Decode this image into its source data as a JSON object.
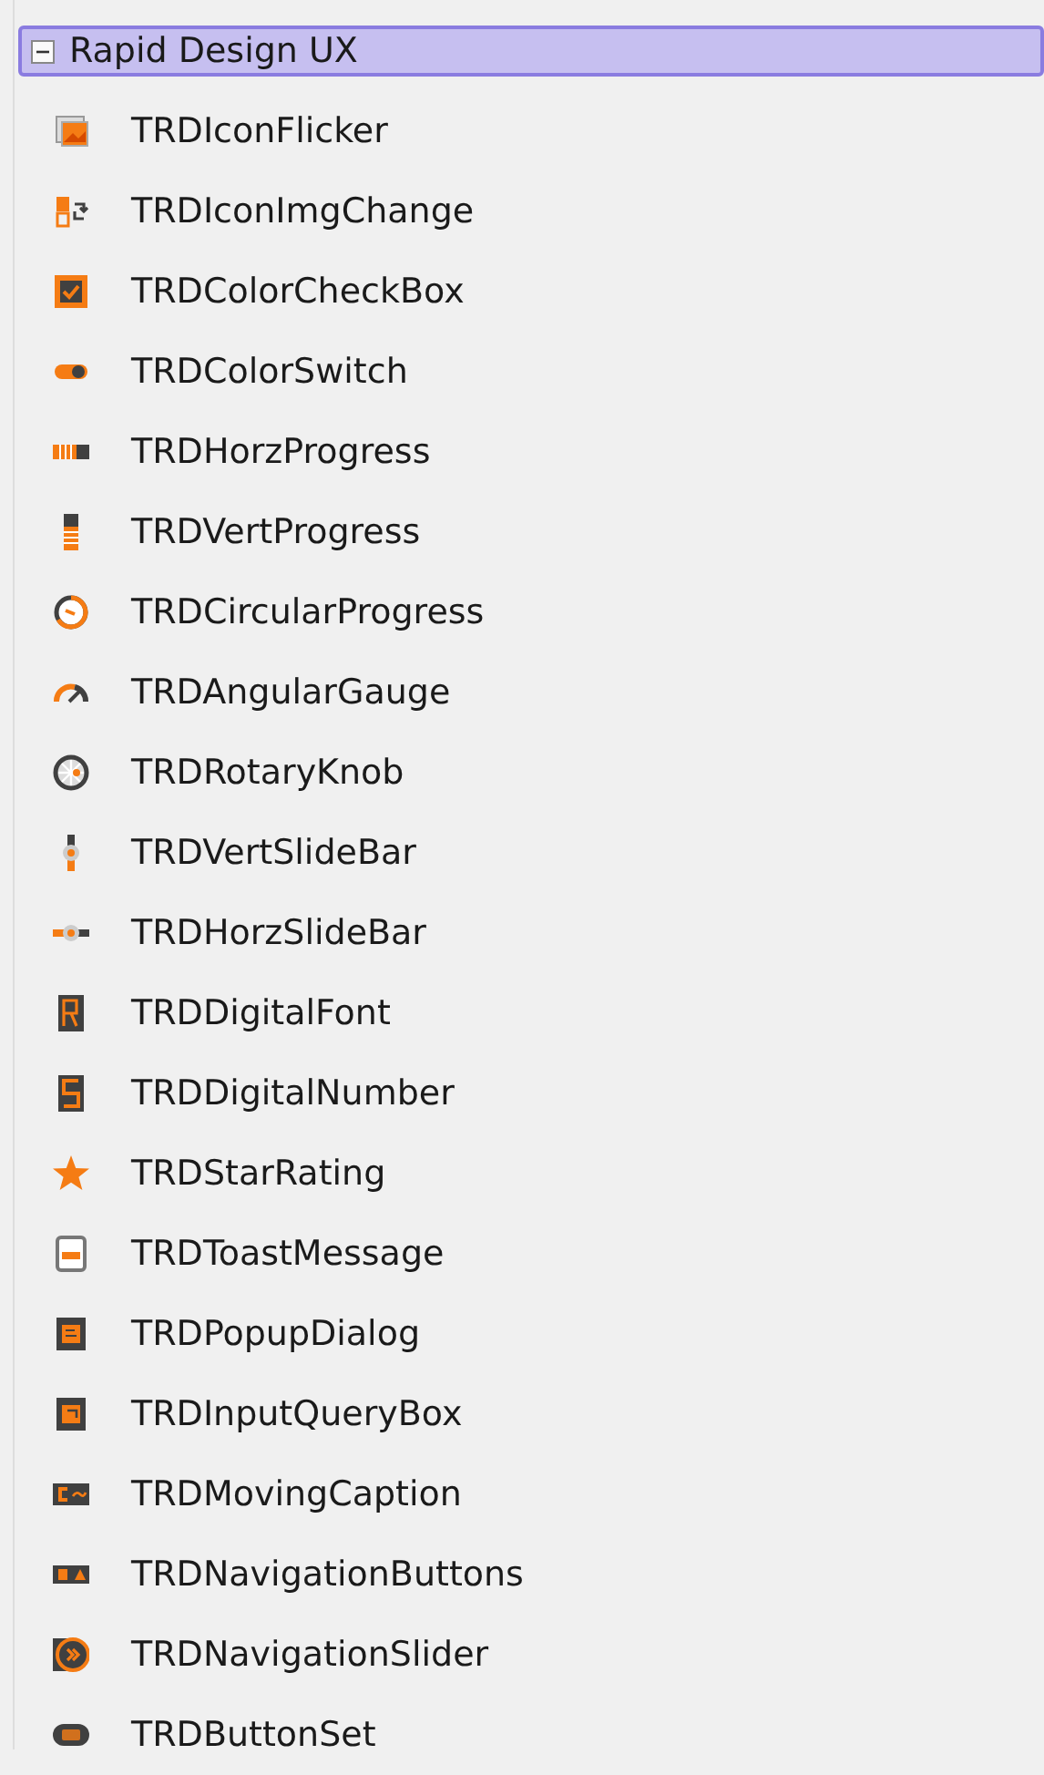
{
  "palette": {
    "category": {
      "label": "Rapid Design UX",
      "expanded": true,
      "selected": true
    },
    "items": [
      {
        "label": "TRDIconFlicker"
      },
      {
        "label": "TRDIconImgChange"
      },
      {
        "label": "TRDColorCheckBox"
      },
      {
        "label": "TRDColorSwitch"
      },
      {
        "label": "TRDHorzProgress"
      },
      {
        "label": "TRDVertProgress"
      },
      {
        "label": "TRDCircularProgress"
      },
      {
        "label": "TRDAngularGauge"
      },
      {
        "label": "TRDRotaryKnob"
      },
      {
        "label": "TRDVertSlideBar"
      },
      {
        "label": "TRDHorzSlideBar"
      },
      {
        "label": "TRDDigitalFont"
      },
      {
        "label": "TRDDigitalNumber"
      },
      {
        "label": "TRDStarRating"
      },
      {
        "label": "TRDToastMessage"
      },
      {
        "label": "TRDPopupDialog"
      },
      {
        "label": "TRDInputQueryBox"
      },
      {
        "label": "TRDMovingCaption"
      },
      {
        "label": "TRDNavigationButtons"
      },
      {
        "label": "TRDNavigationSlider"
      },
      {
        "label": "TRDButtonSet"
      }
    ]
  }
}
